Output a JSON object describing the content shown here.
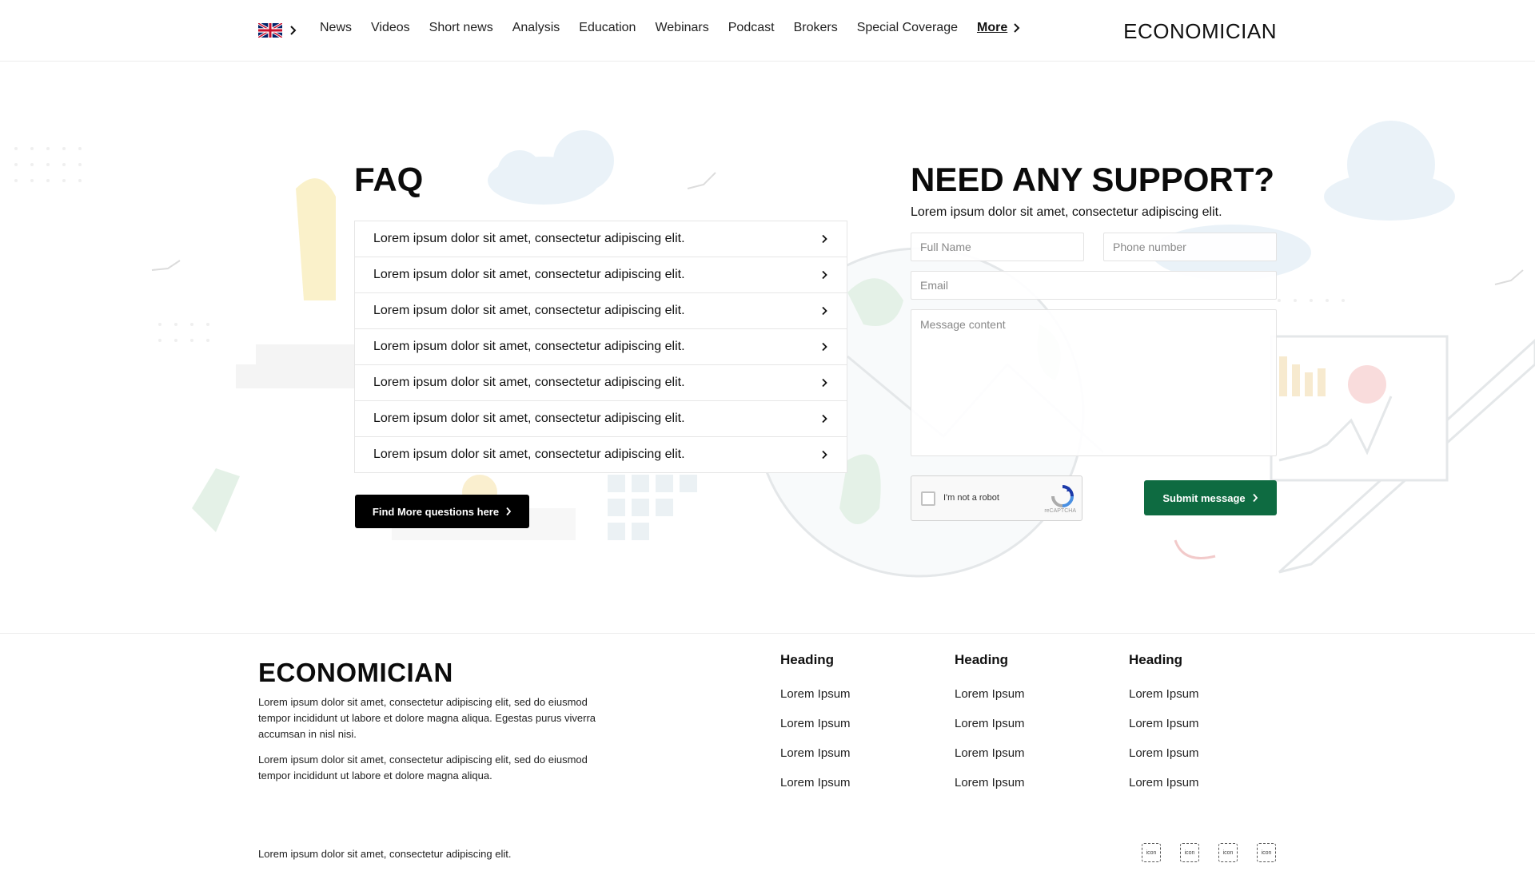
{
  "header": {
    "language": "English (UK)",
    "nav": [
      "News",
      "Videos",
      "Short news",
      "Analysis",
      "Education",
      "Webinars",
      "Podcast",
      "Brokers",
      "Special Coverage"
    ],
    "more_label": "More",
    "brand": "ECONOMICIAN"
  },
  "faq": {
    "title": "FAQ",
    "questions": [
      "Lorem ipsum dolor sit amet, consectetur adipiscing elit.",
      "Lorem ipsum dolor sit amet, consectetur adipiscing elit.",
      "Lorem ipsum dolor sit amet, consectetur adipiscing elit.",
      "Lorem ipsum dolor sit amet, consectetur adipiscing elit.",
      "Lorem ipsum dolor sit amet, consectetur adipiscing elit.",
      "Lorem ipsum dolor sit amet, consectetur adipiscing elit.",
      "Lorem ipsum dolor sit amet, consectetur adipiscing elit."
    ],
    "button_label": "Find More questions here"
  },
  "support": {
    "title": "NEED ANY SUPPORT?",
    "subtitle": "Lorem ipsum dolor sit amet, consectetur adipiscing elit.",
    "full_name_placeholder": "Full Name",
    "phone_placeholder": "Phone number",
    "email_placeholder": "Email",
    "message_placeholder": "Message content",
    "captcha_label": "I'm not a robot",
    "captcha_brand": "reCAPTCHA",
    "submit_label": "Submit message"
  },
  "footer": {
    "brand": "ECONOMICIAN",
    "paragraph1": "Lorem ipsum dolor sit amet, consectetur adipiscing elit, sed do eiusmod tempor incididunt ut labore et dolore magna aliqua. Egestas purus viverra accumsan in nisl nisi.",
    "paragraph2": "Lorem ipsum dolor sit amet, consectetur adipiscing elit, sed do eiusmod tempor incididunt ut labore et dolore magna aliqua.",
    "columns": [
      {
        "heading": "Heading",
        "links": [
          "Lorem Ipsum",
          "Lorem Ipsum",
          "Lorem Ipsum",
          "Lorem Ipsum"
        ]
      },
      {
        "heading": "Heading",
        "links": [
          "Lorem Ipsum",
          "Lorem Ipsum",
          "Lorem Ipsum",
          "Lorem Ipsum"
        ]
      },
      {
        "heading": "Heading",
        "links": [
          "Lorem Ipsum",
          "Lorem Ipsum",
          "Lorem Ipsum",
          "Lorem Ipsum"
        ]
      }
    ],
    "copyright": "Lorem ipsum dolor sit amet, consectetur adipiscing elit.",
    "social_icons": [
      "icon",
      "icon",
      "icon",
      "icon"
    ]
  },
  "colors": {
    "primary_green": "#0e6b41",
    "black_button": "#000000",
    "illustration_green": "#cfe6d4",
    "illustration_blue": "#dbe9f4"
  }
}
